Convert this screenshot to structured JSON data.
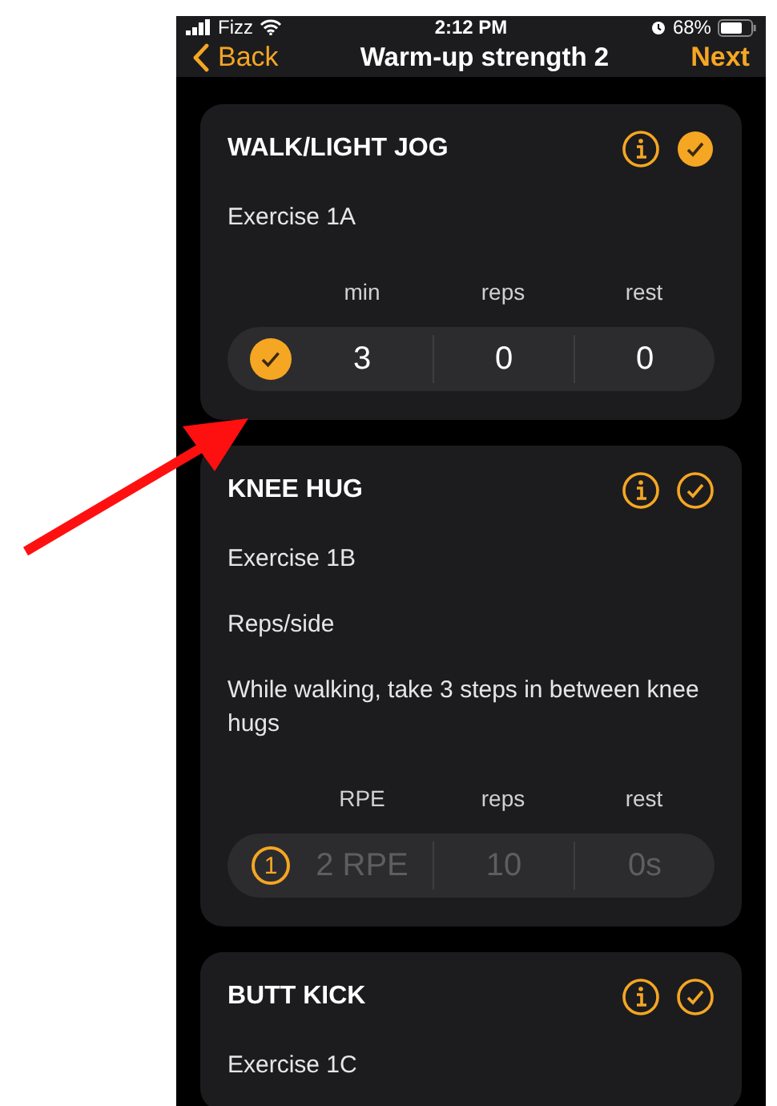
{
  "status_bar": {
    "carrier": "Fizz",
    "time": "2:12 PM",
    "battery": "68%"
  },
  "nav": {
    "back": "Back",
    "title": "Warm-up strength 2",
    "next": "Next"
  },
  "cards": [
    {
      "title": "WALK/LIGHT JOG",
      "completed": true,
      "lines": [
        "Exercise 1A"
      ],
      "columns": [
        "min",
        "reps",
        "rest"
      ],
      "set": {
        "completed": true,
        "values": [
          "3",
          "0",
          "0"
        ]
      }
    },
    {
      "title": "KNEE HUG",
      "completed": false,
      "lines": [
        "Exercise 1B",
        "Reps/side",
        "While walking, take 3 steps in between knee hugs"
      ],
      "columns": [
        "RPE",
        "reps",
        "rest"
      ],
      "set": {
        "completed": false,
        "number": "1",
        "values": [
          "2 RPE",
          "10",
          "0s"
        ]
      }
    },
    {
      "title": "BUTT KICK",
      "completed": false,
      "lines": [
        "Exercise 1C"
      ]
    }
  ]
}
